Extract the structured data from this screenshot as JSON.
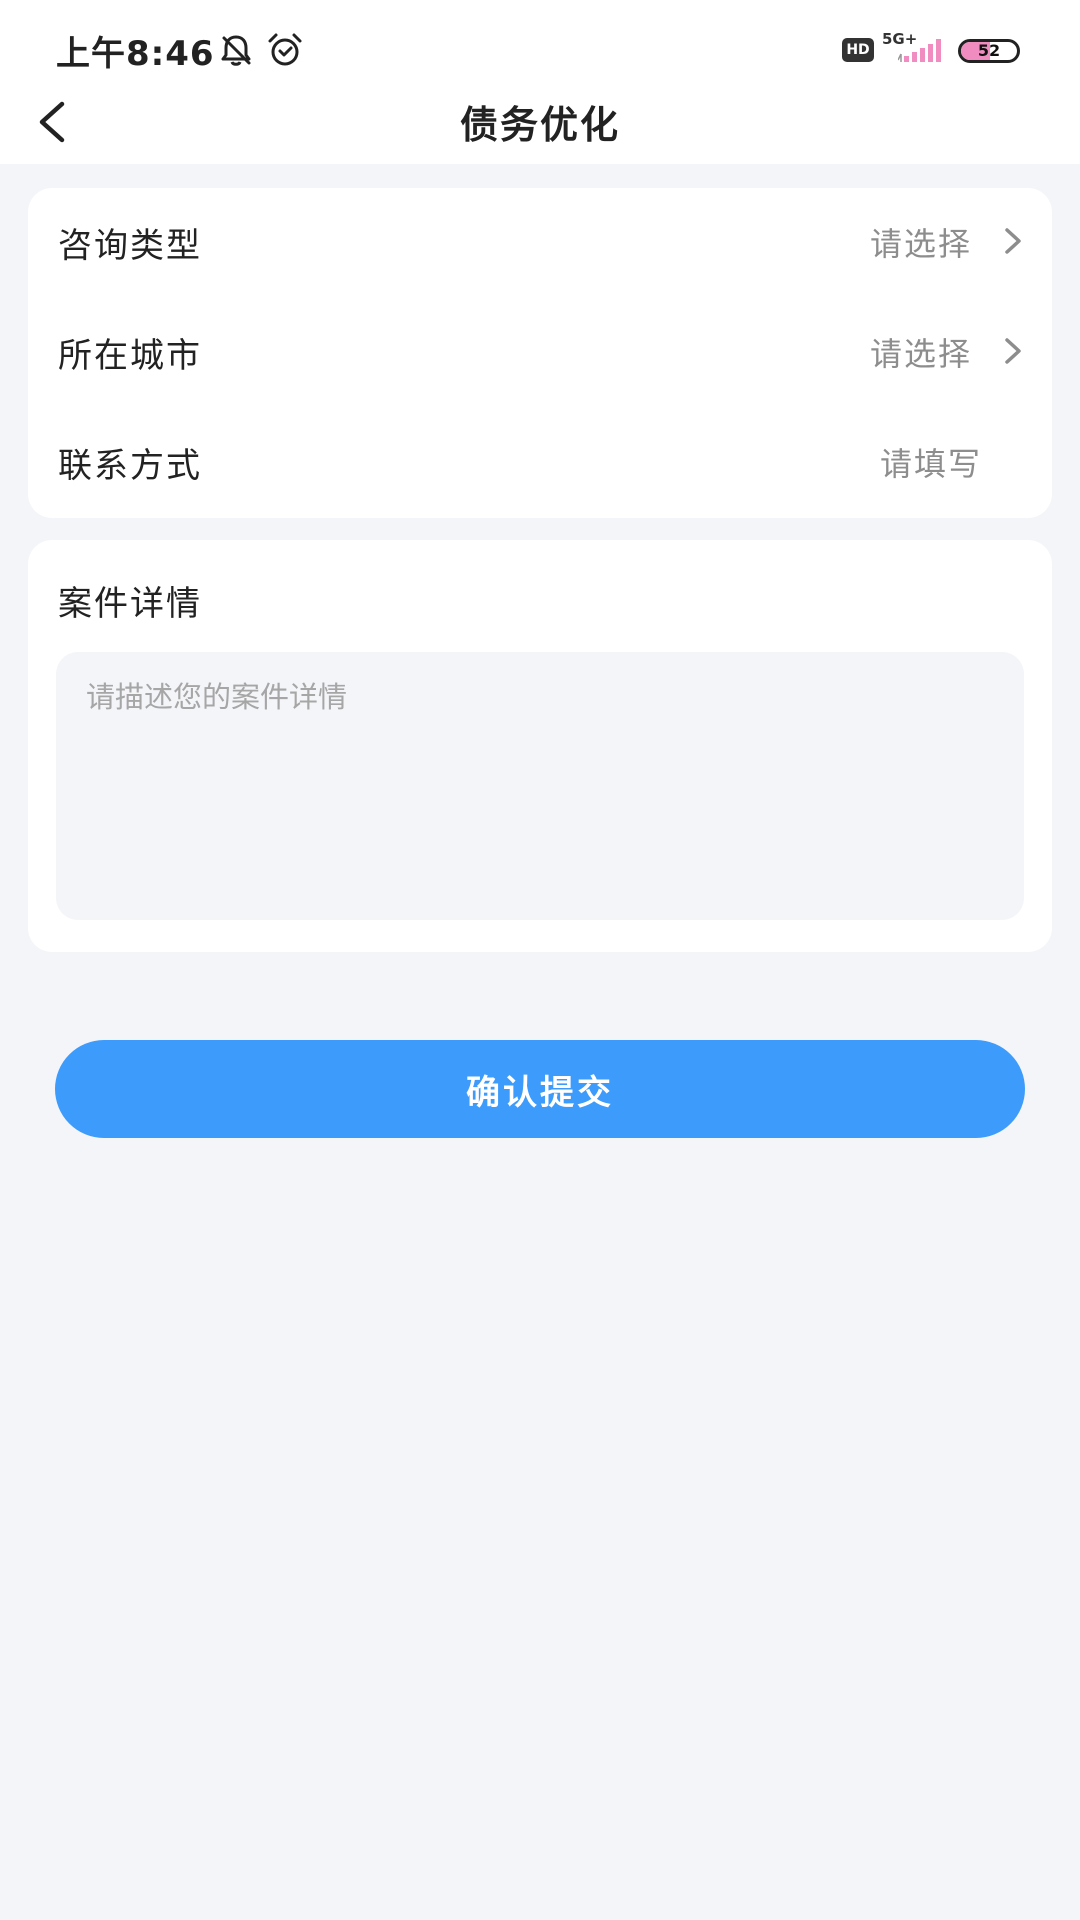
{
  "status_bar": {
    "time": "上午8:46",
    "network": "5G+",
    "hd": "HD",
    "battery_percent": "52",
    "battery_level": 0.52
  },
  "header": {
    "title": "债务优化"
  },
  "form": {
    "rows": [
      {
        "label": "咨询类型",
        "value": "请选择"
      },
      {
        "label": "所在城市",
        "value": "请选择"
      },
      {
        "label": "联系方式",
        "value": "请填写"
      }
    ]
  },
  "detail": {
    "title": "案件详情",
    "placeholder": "请描述您的案件详情"
  },
  "submit": {
    "label": "确认提交"
  },
  "colors": {
    "primary": "#3d9bfb",
    "background": "#f4f5f9",
    "battery": "#f08cbf"
  }
}
